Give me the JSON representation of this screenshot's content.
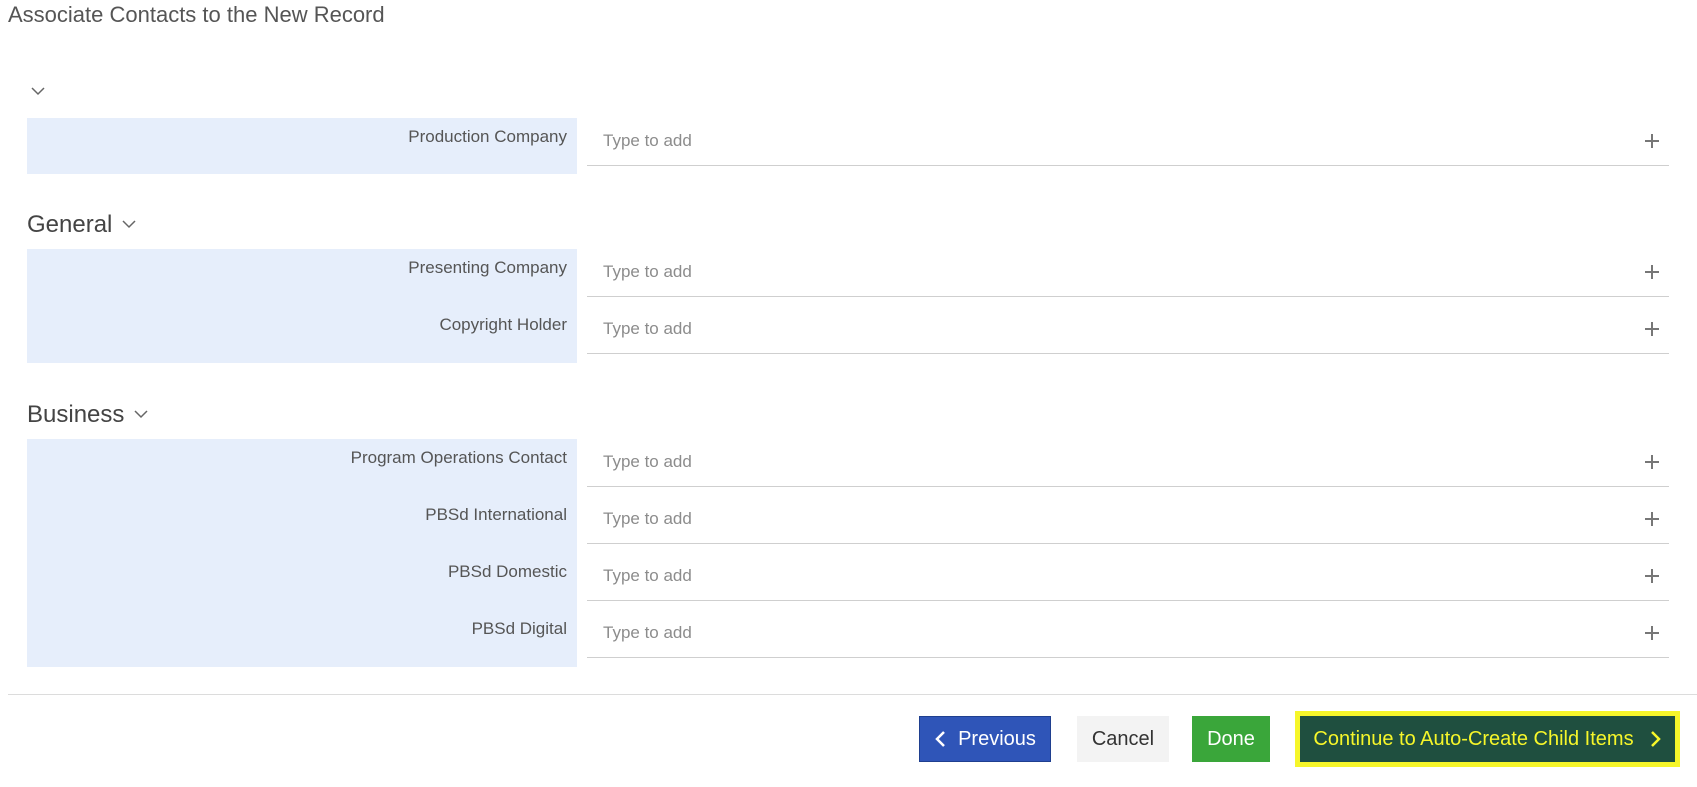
{
  "page": {
    "title": "Associate Contacts to the New Record"
  },
  "sections": [
    {
      "title": "",
      "fields": [
        {
          "label": "Production Company",
          "placeholder": "Type to add"
        }
      ]
    },
    {
      "title": "General",
      "fields": [
        {
          "label": "Presenting Company",
          "placeholder": "Type to add"
        },
        {
          "label": "Copyright Holder",
          "placeholder": "Type to add"
        }
      ]
    },
    {
      "title": "Business",
      "fields": [
        {
          "label": "Program Operations Contact",
          "placeholder": "Type to add"
        },
        {
          "label": "PBSd International",
          "placeholder": "Type to add"
        },
        {
          "label": "PBSd Domestic",
          "placeholder": "Type to add"
        },
        {
          "label": "PBSd Digital",
          "placeholder": "Type to add"
        }
      ]
    }
  ],
  "footer": {
    "previous_label": "Previous",
    "cancel_label": "Cancel",
    "done_label": "Done",
    "continue_label": "Continue to Auto-Create Child Items"
  },
  "icons": {
    "chevron": "chevron-down-icon",
    "plus": "plus-icon",
    "previous_arrow": "chevron-left-icon",
    "continue_arrow": "chevron-right-icon"
  },
  "colors": {
    "label_panel_bg": "#e6eefb",
    "previous_bg": "#2f55b8",
    "done_bg": "#3aa63a",
    "continue_bg": "#1f4f3f",
    "continue_highlight": "#f6f62a"
  }
}
